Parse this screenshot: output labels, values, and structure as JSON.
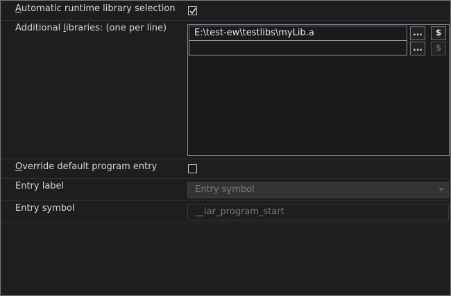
{
  "auto_runtime": {
    "label_mnemonic": "A",
    "label_rest": "utomatic runtime library selection",
    "checked": true
  },
  "additional_libs": {
    "label_pre": "Additional ",
    "label_mnemonic": "l",
    "label_post": "ibraries: (one per line)",
    "rows": [
      {
        "value": "E:\\test-ew\\testlibs\\myLib.a",
        "browse_label": "...",
        "var_label": "$"
      },
      {
        "value": "",
        "browse_label": "...",
        "var_label": "$"
      }
    ]
  },
  "override_entry": {
    "label_mnemonic": "O",
    "label_rest": "verride default program entry",
    "checked": false
  },
  "entry_label": {
    "label": "Entry label",
    "selected": "Entry symbol"
  },
  "entry_symbol": {
    "label": "Entry symbol",
    "value": "__iar_program_start"
  },
  "colors": {
    "background": "#1e1e1e",
    "focus_border": "#5a6ac8",
    "disabled_text": "#7c7c7c"
  }
}
